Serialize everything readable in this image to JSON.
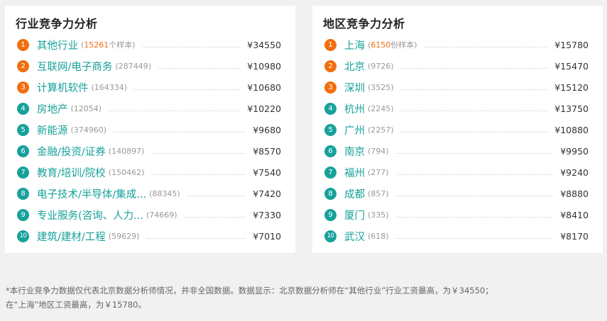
{
  "colors": {
    "accent_orange": "#f26e10",
    "accent_teal": "#17a19a",
    "background": "#f1f1f1",
    "panel": "#ffffff"
  },
  "industry": {
    "title": "行业竞争力分析",
    "sample_suffix": "个样本",
    "items": [
      {
        "rank": "1",
        "name": "其他行业",
        "count": "15261",
        "value": "¥34550",
        "badge": "orange",
        "highlight": true
      },
      {
        "rank": "2",
        "name": "互联网/电子商务",
        "count": "287449",
        "value": "¥10980",
        "badge": "orange"
      },
      {
        "rank": "3",
        "name": "计算机软件",
        "count": "164334",
        "value": "¥10680",
        "badge": "orange"
      },
      {
        "rank": "4",
        "name": "房地产",
        "count": "12054",
        "value": "¥10220",
        "badge": "teal"
      },
      {
        "rank": "5",
        "name": "新能源",
        "count": "374960",
        "value": "¥9680",
        "badge": "teal"
      },
      {
        "rank": "6",
        "name": "金融/投资/证券",
        "count": "140897",
        "value": "¥8570",
        "badge": "teal"
      },
      {
        "rank": "7",
        "name": "教育/培训/院校",
        "count": "150462",
        "value": "¥7540",
        "badge": "teal"
      },
      {
        "rank": "8",
        "name": "电子技术/半导体/集成...",
        "count": "88345",
        "value": "¥7420",
        "badge": "teal"
      },
      {
        "rank": "9",
        "name": "专业服务(咨询、人力...",
        "count": "74669",
        "value": "¥7330",
        "badge": "teal"
      },
      {
        "rank": "10",
        "name": "建筑/建材/工程",
        "count": "59629",
        "value": "¥7010",
        "badge": "teal"
      }
    ]
  },
  "region": {
    "title": "地区竞争力分析",
    "sample_suffix": "份样本",
    "items": [
      {
        "rank": "1",
        "name": "上海",
        "count": "6150",
        "value": "¥15780",
        "badge": "orange",
        "highlight": true
      },
      {
        "rank": "2",
        "name": "北京",
        "count": "9726",
        "value": "¥15470",
        "badge": "orange"
      },
      {
        "rank": "3",
        "name": "深圳",
        "count": "3525",
        "value": "¥15120",
        "badge": "orange"
      },
      {
        "rank": "4",
        "name": "杭州",
        "count": "2245",
        "value": "¥13750",
        "badge": "teal"
      },
      {
        "rank": "5",
        "name": "广州",
        "count": "2257",
        "value": "¥10880",
        "badge": "teal"
      },
      {
        "rank": "6",
        "name": "南京",
        "count": "794",
        "value": "¥9950",
        "badge": "teal"
      },
      {
        "rank": "7",
        "name": "福州",
        "count": "277",
        "value": "¥9240",
        "badge": "teal"
      },
      {
        "rank": "8",
        "name": "成都",
        "count": "857",
        "value": "¥8880",
        "badge": "teal"
      },
      {
        "rank": "9",
        "name": "厦门",
        "count": "335",
        "value": "¥8410",
        "badge": "teal"
      },
      {
        "rank": "10",
        "name": "武汉",
        "count": "618",
        "value": "¥8170",
        "badge": "teal"
      }
    ]
  },
  "footnote": {
    "line1": "*本行业竞争力数据仅代表北京数据分析师情况，并非全国数据。数据显示：北京数据分析师在“其他行业”行业工资最高，为￥34550；",
    "line2": "在“上海”地区工资最高，为￥15780。"
  }
}
